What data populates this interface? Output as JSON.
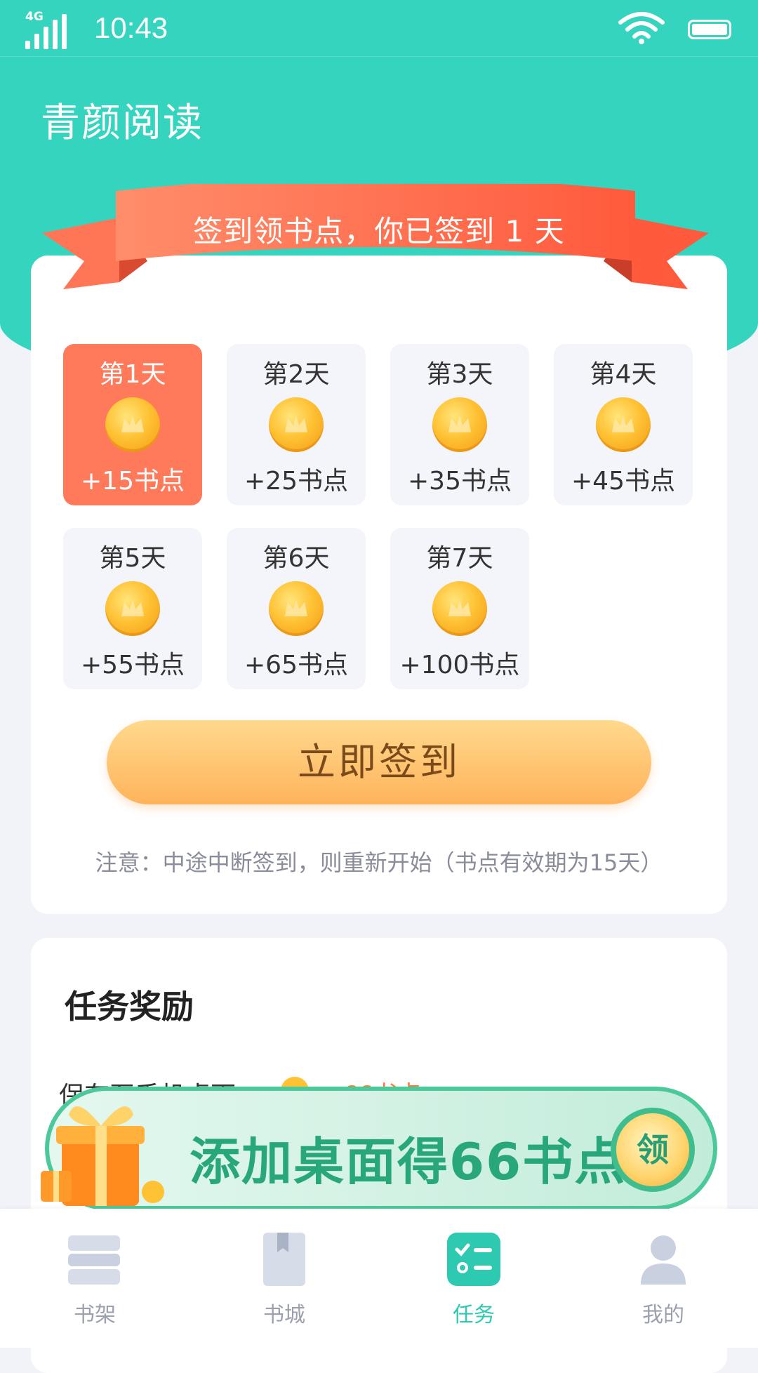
{
  "status_bar": {
    "time": "10:43",
    "network": "4G"
  },
  "header": {
    "title": "青颜阅读"
  },
  "signin": {
    "banner_text": "签到领书点，你已签到 1 天",
    "days": [
      {
        "label": "第1天",
        "reward": "+15书点",
        "active": true
      },
      {
        "label": "第2天",
        "reward": "+25书点",
        "active": false
      },
      {
        "label": "第3天",
        "reward": "+35书点",
        "active": false
      },
      {
        "label": "第4天",
        "reward": "+45书点",
        "active": false
      },
      {
        "label": "第5天",
        "reward": "+55书点",
        "active": false
      },
      {
        "label": "第6天",
        "reward": "+65书点",
        "active": false
      },
      {
        "label": "第7天",
        "reward": "+100书点",
        "active": false
      }
    ],
    "button_label": "立即签到",
    "notice": "注意：中途中断签到，则重新开始（书点有效期为15天）"
  },
  "tasks": {
    "title": "任务奖励",
    "first_row_label": "保存至手机桌面",
    "first_row_reward": "+66书点"
  },
  "promo_banner": {
    "text": "添加桌面得66书点",
    "claim_label": "领"
  },
  "tab_bar": {
    "items": [
      {
        "label": "书架",
        "icon": "bookshelf-icon"
      },
      {
        "label": "书城",
        "icon": "bookstore-icon"
      },
      {
        "label": "任务",
        "icon": "task-icon"
      },
      {
        "label": "我的",
        "icon": "profile-icon"
      }
    ],
    "active_index": 2
  },
  "colors": {
    "accent": "#34d4bf",
    "active_day": "#ff7a5a",
    "button_top": "#ffd98d",
    "button_bottom": "#ffb35b",
    "banner_green": "#28a77b"
  }
}
